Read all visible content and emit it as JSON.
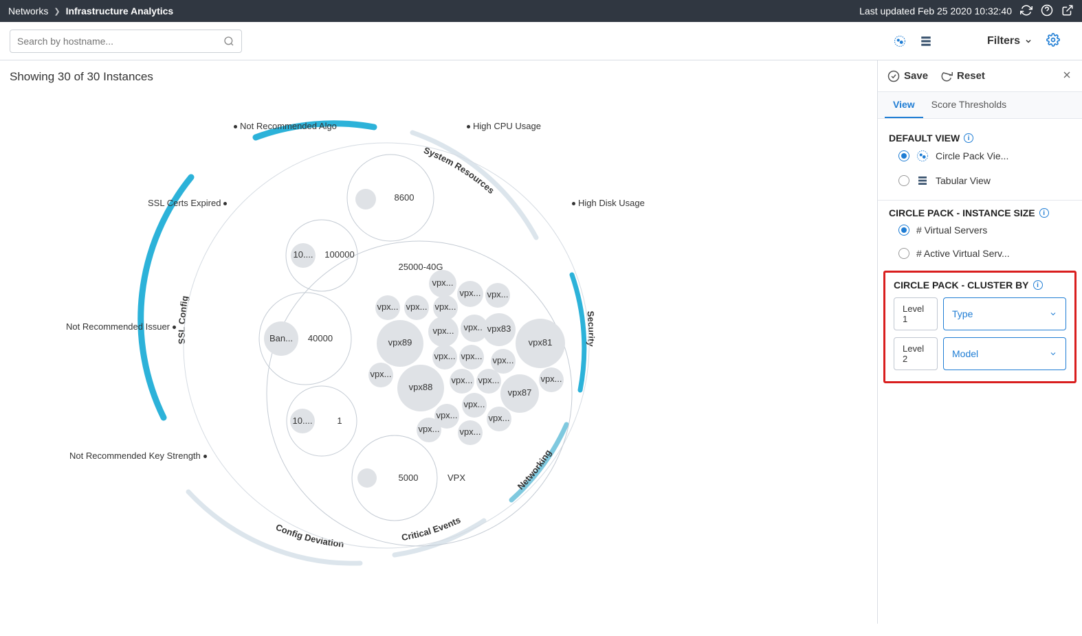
{
  "header": {
    "crumb1": "Networks",
    "crumb2": "Infrastructure Analytics",
    "last_updated": "Last updated Feb 25 2020 10:32:40"
  },
  "search": {
    "placeholder": "Search by hostname..."
  },
  "filters_label": "Filters",
  "showing": "Showing 30 of 30 Instances",
  "outer_labels": {
    "not_rec_algo": "Not Recommended Algo",
    "high_cpu": "High CPU Usage",
    "ssl_expired": "SSL Certs Expired",
    "high_disk": "High Disk Usage",
    "not_rec_issuer": "Not Recommended Issuer",
    "not_rec_key": "Not Recommended Key Strength"
  },
  "arcs": {
    "sys_res": "System Resources",
    "ssl_config": "SSL Config",
    "security": "Security",
    "networking": "Networking",
    "crit_events": "Critical Events",
    "config_dev": "Config Deviation"
  },
  "big_bubbles": {
    "b8600": "8600",
    "b100000_a": "10....",
    "b100000_b": "100000",
    "b25000": "25000-40G",
    "b40000_a": "Ban...",
    "b40000_b": "40000",
    "b1_a": "10....",
    "b1_b": "1",
    "b5000": "5000",
    "bvpx": "VPX"
  },
  "small": {
    "vpx89": "vpx89",
    "vpx88": "vpx88",
    "vpx87": "vpx87",
    "vpx83": "vpx83",
    "vpx81": "vpx81",
    "t": "vpx..."
  },
  "panel": {
    "save": "Save",
    "reset": "Reset",
    "tab_view": "View",
    "tab_thresh": "Score Thresholds",
    "s1": "DEFAULT VIEW",
    "r1": "Circle Pack Vie...",
    "r2": "Tabular View",
    "s2": "CIRCLE PACK - INSTANCE SIZE",
    "r3": "# Virtual Servers",
    "r4": "# Active Virtual Serv...",
    "s3": "CIRCLE PACK - CLUSTER BY",
    "l1": "Level 1",
    "l1v": "Type",
    "l2": "Level 2",
    "l2v": "Model"
  }
}
